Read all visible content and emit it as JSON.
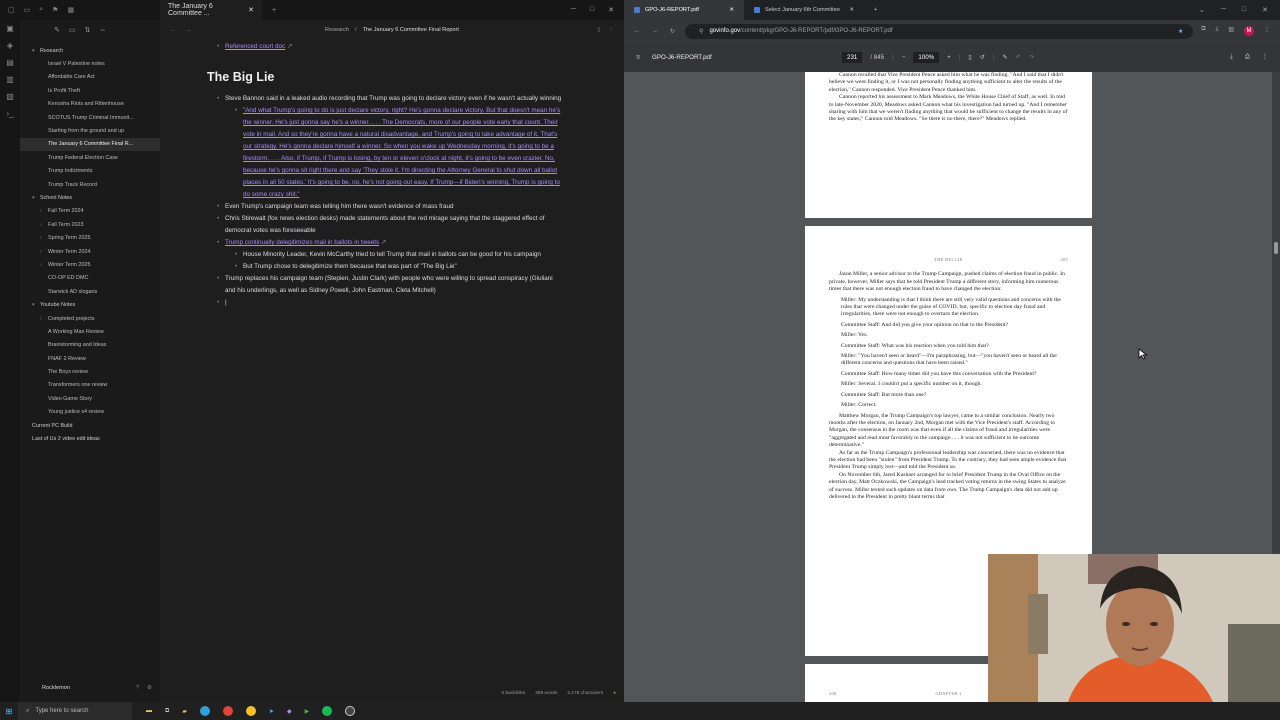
{
  "obsidian": {
    "tab_title": "The January 6 Committee ...",
    "breadcrumb_folder": "Research",
    "breadcrumb_sep": "/",
    "breadcrumb_file": "The January 6 Committee Final Report",
    "tree": [
      {
        "label": "Research",
        "level": 0,
        "folder": true
      },
      {
        "label": "Israel V Palestine notes",
        "level": 1
      },
      {
        "label": "Affordable Care Act",
        "level": 1
      },
      {
        "label": "Is Profit Theft",
        "level": 1
      },
      {
        "label": "Kenosha Riots and Rittenhouse",
        "level": 1
      },
      {
        "label": "SCOTUS Trump Criminal Immunit...",
        "level": 1
      },
      {
        "label": "Starting from the ground and up",
        "level": 1
      },
      {
        "label": "The January 6 Committee Final R...",
        "level": 1,
        "active": true
      },
      {
        "label": "Trump Federal Election Case",
        "level": 1
      },
      {
        "label": "Trump Indictments",
        "level": 1
      },
      {
        "label": "Trump Track Record",
        "level": 1
      },
      {
        "label": "School Notes",
        "level": 0,
        "folder": true
      },
      {
        "label": "Fall Term 2024",
        "level": 1,
        "folder": true
      },
      {
        "label": "Fall Term 2023",
        "level": 1,
        "folder": true
      },
      {
        "label": "Spring Term 2025",
        "level": 1,
        "folder": true
      },
      {
        "label": "Winter Term 2024",
        "level": 1,
        "folder": true
      },
      {
        "label": "Winter Term 2025",
        "level": 1,
        "folder": true
      },
      {
        "label": "CO-OP ED DMC",
        "level": 1
      },
      {
        "label": "Starwick AD slogans",
        "level": 1
      },
      {
        "label": "Youtube Notes",
        "level": 0,
        "folder": true
      },
      {
        "label": "Completed projects",
        "level": 1,
        "folder": true
      },
      {
        "label": "A Working Man Review",
        "level": 1
      },
      {
        "label": "Brainstorming and Ideas",
        "level": 1
      },
      {
        "label": "FNAF 2 Review",
        "level": 1
      },
      {
        "label": "The Boys review",
        "level": 1
      },
      {
        "label": "Transformers one review",
        "level": 1
      },
      {
        "label": "Video Game Story",
        "level": 1
      },
      {
        "label": "Young justice s4 review",
        "level": 1
      },
      {
        "label": "Current PC Build",
        "level": 0
      },
      {
        "label": "Last of Us 2 video edit ideas",
        "level": 0
      }
    ],
    "vault_name": "Rocklemon",
    "top_link": "Referenced court doc",
    "heading": "The Big Lie",
    "bullets": {
      "b1": "Steve Bannon said in a leaked audio recording that Trump was going to declare victory even if he wasn't actually winning",
      "b1_quote": "\"And what Trump's going to do is just declare victory, right? He's gonna declare victory. But that doesn't mean he's the winner. He's just gonna say he's a winner. . . . The Democrats, more of our people vote early that count. Their vote in mail. And so they're gonna have a natural disadvantage, and Trump's going to take advantage of it. That's our strategy. He's gonna declare himself a winner. So when you wake up Wednesday morning, it's going to be a firestorm. . . . Also, if Trump, if Trump is losing, by ten or eleven o'clock at night, it's going to be even crazier. No, because he's gonna sit right there and say 'They stole it. I'm directing the Attorney General to shut down all ballot places in all 50 states.' It's going to be, no, he's not going out easy. If Trump—if Biden's winning, Trump is going to do some crazy shit.\"",
      "b2": "Even Trump's campaign team was telling him there wasn't evidence of mass fraud",
      "b3": "Chris Stirewalt (fox news election desks) made statements about the red mirage saying that the staggered effect of democrat votes was foreseeable",
      "b4": "Trump continually delegitimizes mail in ballots in tweets",
      "b4a": "House Minority Leader, Kevin McCarthy tried to tell Trump that mail in ballots can be good for his campaign",
      "b4b": "But Trump chose to delegitimize them because that was part of \"The Big Lie\"",
      "b5": "Trump replaces his campaign team (Stepien, Justin Clark) with people who were willing to spread conspiracy (Giuliani and his underlings, as well as Sidney Powell, John Eastman, Cleta Mitchell)"
    },
    "status": {
      "backlinks": "0 backlinks",
      "words": "369 words",
      "chars": "2,176 characters"
    }
  },
  "chrome": {
    "tab1": "GPO-J6-REPORT.pdf",
    "tab2": "Select January 6th Committee",
    "url_host": "govinfo.gov",
    "url_path": "/content/pkg/GPO-J6-REPORT/pdf/GPO-J6-REPORT.pdf",
    "profile_initial": "M",
    "pdf_name": "GPO-J6-REPORT.pdf",
    "page_current": "231",
    "page_total": "/ 845",
    "zoom": "100%"
  },
  "pdf": {
    "top_paras": [
      "Cannon recalled that Vice President Pence asked him what he was finding. \"And I said that I didn't believe we were finding it, or I was not personally finding anything sufficient to alter the results of the election,\" Cannon responded. Vice President Pence thanked him.",
      "Cannon reported his assessment to Mark Meadows, the White House Chief of Staff, as well. In mid to late-November 2020, Meadows asked Cannon what his investigation had turned up. \"And I remember sharing with him that we weren't finding anything that would be sufficient to change the results in any of the key states,\" Cannon told Meadows. \"So there is no there, there?\" Meadows replied."
    ],
    "runhead": "THE BIG LIE",
    "page_no": "205",
    "intro": "Jason Miller, a senior advisor to the Trump Campaign, pushed claims of election fraud in public. In private, however, Miller says that he told President Trump a different story, informing him numerous times that there was not enough election fraud to have changed the election:",
    "dialogue": [
      "Miller: My understanding is that I think there are still very valid questions and concerns with the rules that were changed under the guise of COVID, but, specific to election day fraud and irregularities, there were not enough to overturn the election.",
      "Committee Staff: And did you give your opinion on that to the President?",
      "Miller: Yes.",
      "Committee Staff: What was his reaction when you told him that?",
      "Miller: \"You haven't seen or heard\"—I'm paraphrasing, but—\"you haven't seen or heard all the different concerns and questions that have been raised.\"",
      "Committee Staff: How many times did you have this conversation with the President?",
      "Miller: Several. I couldn't put a specific number on it, though.",
      "Committee Staff: But more than one?",
      "Miller: Correct."
    ],
    "paras": [
      "Matthew Morgan, the Trump Campaign's top lawyer, came to a similar conclusion. Nearly two months after the election, on January 2nd, Morgan met with the Vice President's staff. According to Morgan, the consensus in the room was that even if all the claims of fraud and irregularities were \"aggregated and read most favorably to the campaign . . . it was not sufficient to be outcome determinative.\"",
      "As far as the Trump Campaign's professional leadership was concerned, there was no evidence that the election had been \"stolen\" from President Trump. To the contrary, they had seen ample evidence that President Trump simply lost—and told the President so.",
      "On November 6th, Jared Kushner arranged for to brief President Trump in the Oval Office on the election day, Matt Oczkowski, the Campaign's lead tracked voting returns in the swing States to analyze of success. Miller texted such updates on data from ows. The Trump Campaign's data did not add up delivered to the President in pretty blunt terms that"
    ],
    "next_runhead": "CHAPTER 1",
    "next_page_no": "206"
  },
  "taskbar": {
    "search_placeholder": "Type here to search"
  }
}
